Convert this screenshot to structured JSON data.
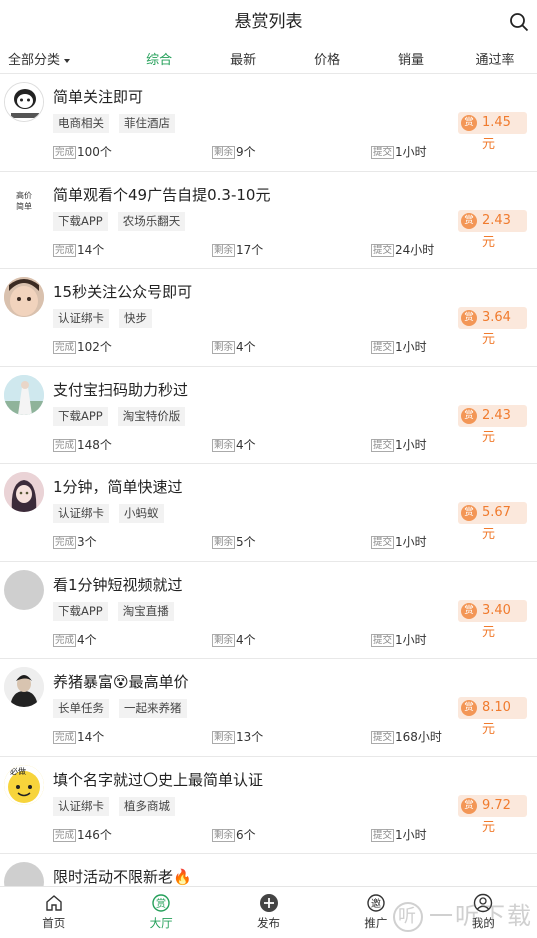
{
  "header": {
    "title": "悬赏列表"
  },
  "filters": [
    "全部分类",
    "综合",
    "最新",
    "价格",
    "销量",
    "通过率"
  ],
  "labels": {
    "done": "完成",
    "remain": "剩余",
    "submit": "提交",
    "reward": "赏"
  },
  "items": [
    {
      "title": "简单关注即可",
      "tags": [
        "电商相关",
        "菲住酒店"
      ],
      "done": "100个",
      "remain": "9个",
      "submit": "1小时",
      "price": "1.45 元"
    },
    {
      "title": "简单观看个49广告自提0.3-10元",
      "tags": [
        "下载APP",
        "农场乐翻天"
      ],
      "done": "14个",
      "remain": "17个",
      "submit": "24小时",
      "price": "2.43 元"
    },
    {
      "title": "15秒关注公众号即可",
      "tags": [
        "认证绑卡",
        "快步"
      ],
      "done": "102个",
      "remain": "4个",
      "submit": "1小时",
      "price": "3.64 元"
    },
    {
      "title": "支付宝扫码助力秒过",
      "tags": [
        "下载APP",
        "淘宝特价版"
      ],
      "done": "148个",
      "remain": "4个",
      "submit": "1小时",
      "price": "2.43 元"
    },
    {
      "title": "1分钟，简单快速过",
      "tags": [
        "认证绑卡",
        "小蚂蚁"
      ],
      "done": "3个",
      "remain": "5个",
      "submit": "1小时",
      "price": "5.67 元"
    },
    {
      "title": "看1分钟短视频就过",
      "tags": [
        "下载APP",
        "淘宝直播"
      ],
      "done": "4个",
      "remain": "4个",
      "submit": "1小时",
      "price": "3.40 元"
    },
    {
      "title": "养猪暴富😵最高单价",
      "tags": [
        "长单任务",
        "一起来养猪"
      ],
      "done": "14个",
      "remain": "13个",
      "submit": "168小时",
      "price": "8.10 元"
    },
    {
      "title": "填个名字就过〇史上最简单认证",
      "tags": [
        "认证绑卡",
        "植多商城"
      ],
      "done": "146个",
      "remain": "6个",
      "submit": "1小时",
      "price": "9.72 元"
    },
    {
      "title": "限时活动不限新老🔥"
    }
  ],
  "avatar_text": {
    "item2": "高价\n简单",
    "item8": "必做"
  },
  "tabbar": [
    "首页",
    "大厅",
    "发布",
    "推广",
    "我的"
  ],
  "watermark": {
    "circle": "听",
    "text": "一听下载"
  },
  "colors": {
    "accent": "#25a05a",
    "price_text": "#f07b2e",
    "price_bg": "#fbe8dc",
    "badge": "#f39656"
  }
}
